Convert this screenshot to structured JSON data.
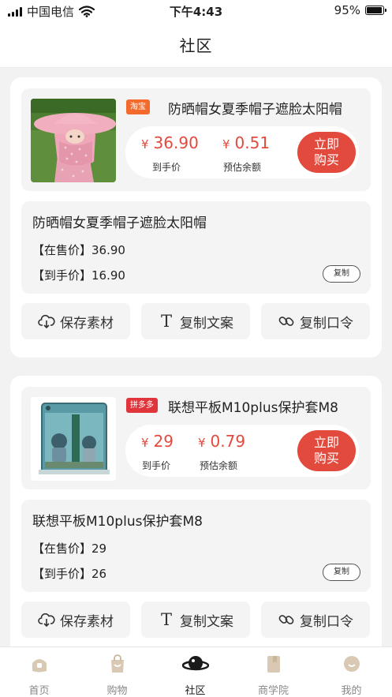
{
  "status_bar": {
    "carrier": "中国电信",
    "time": "下午4:43",
    "battery": "95%",
    "battery_level": 0.95
  },
  "header": {
    "title": "社区"
  },
  "posts": [
    {
      "platform": "淘宝",
      "platform_color": "#f26a2c",
      "product_title": "防晒帽女夏季帽子遮脸太阳帽",
      "final_price": "36.90",
      "final_price_label": "到手价",
      "estimated_earning": "0.51",
      "estimated_earning_label": "预估余额",
      "currency": "¥",
      "buy_label": "立即购买",
      "copy_title": "防晒帽女夏季帽子遮脸太阳帽",
      "sale_price_line": "【在售价】36.90",
      "final_price_line": "【到手价】16.90",
      "copy_button": "复制",
      "actions": [
        "保存素材",
        "复制文案",
        "复制口令"
      ]
    },
    {
      "platform": "拼多多",
      "platform_color": "#e0353a",
      "product_title": "联想平板M10plus保护套M8",
      "final_price": "29",
      "final_price_label": "到手价",
      "estimated_earning": "0.79",
      "estimated_earning_label": "预估余额",
      "currency": "¥",
      "buy_label": "立即购买",
      "copy_title": "联想平板M10plus保护套M8",
      "sale_price_line": "【在售价】29",
      "final_price_line": "【到手价】26",
      "copy_button": "复制",
      "actions": [
        "保存素材",
        "复制文案",
        "复制口令"
      ]
    }
  ],
  "tab_bar": {
    "items": [
      {
        "label": "首页",
        "icon": "home-icon"
      },
      {
        "label": "购物",
        "icon": "shopping-bag-icon"
      },
      {
        "label": "社区",
        "icon": "planet-icon",
        "active": true
      },
      {
        "label": "商学院",
        "icon": "book-icon"
      },
      {
        "label": "我的",
        "icon": "profile-icon"
      }
    ]
  },
  "colors": {
    "accent": "#e34a3e",
    "taobao": "#f26a2c",
    "pinduoduo": "#e0353a",
    "background": "#f2f2f2"
  }
}
